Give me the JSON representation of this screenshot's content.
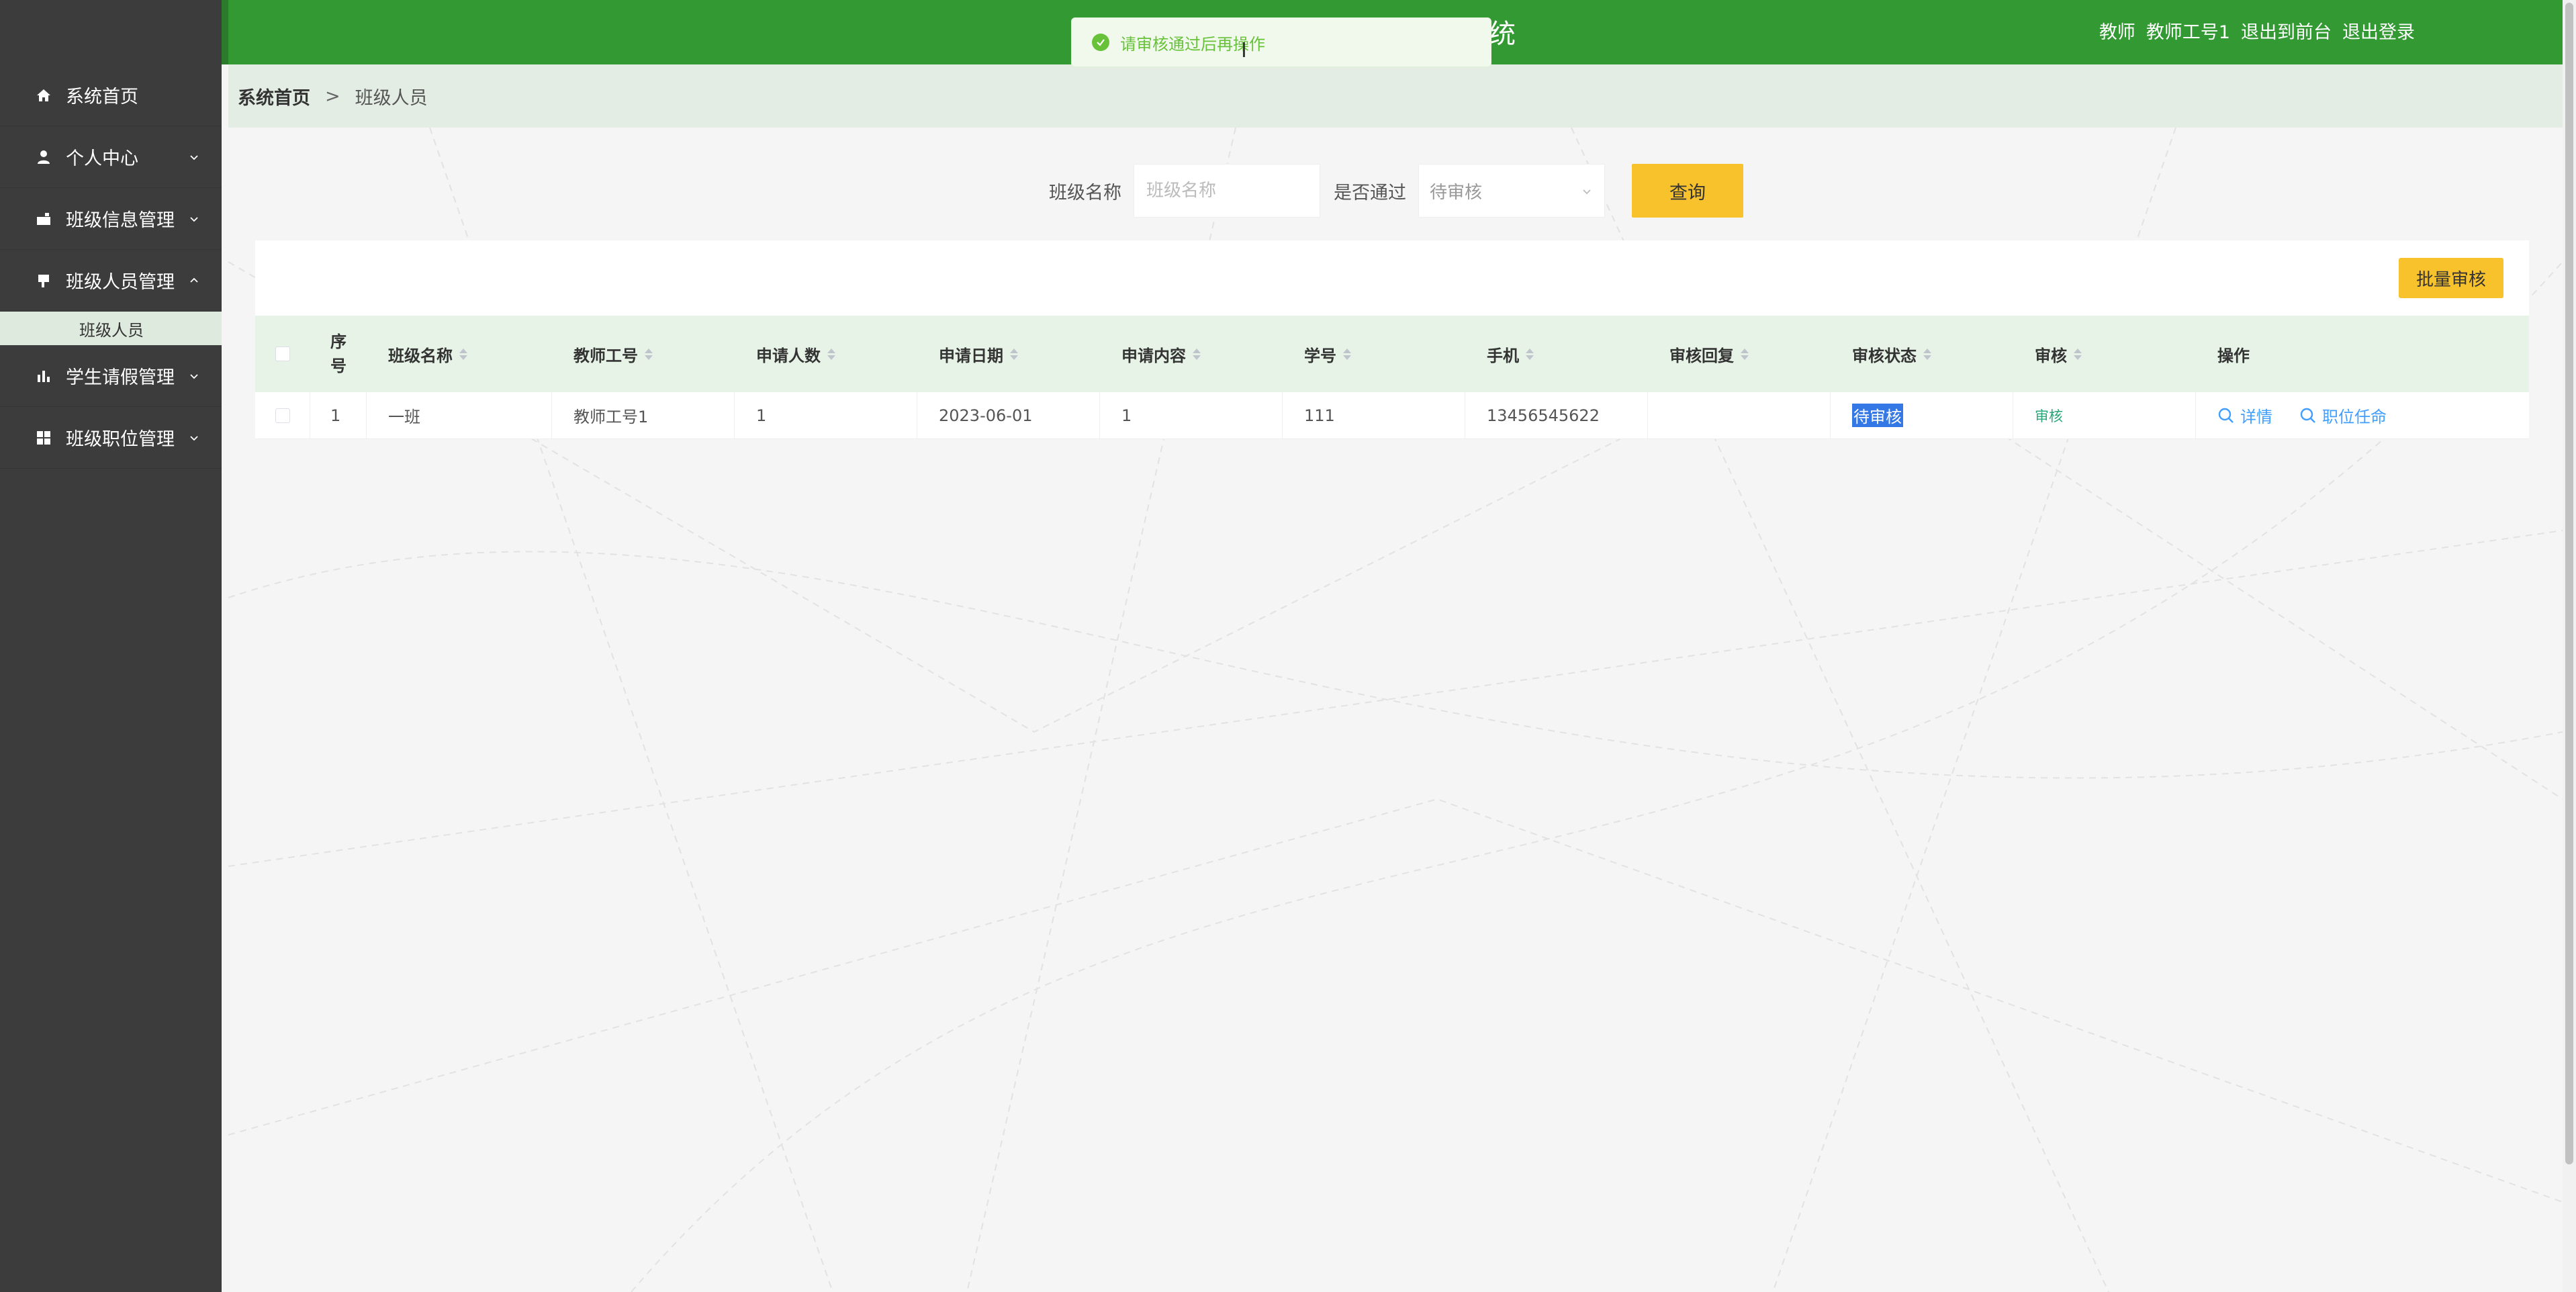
{
  "header": {
    "title": "统",
    "user_role": "教师",
    "user_name": "教师工号1",
    "back_to_front": "退出到前台",
    "logout": "退出登录"
  },
  "toast": {
    "message": "请审核通过后再操作"
  },
  "sidebar": {
    "items": [
      {
        "label": "系统首页",
        "icon": "home-icon"
      },
      {
        "label": "个人中心",
        "icon": "user-icon"
      },
      {
        "label": "班级信息管理",
        "icon": "briefcase-icon"
      },
      {
        "label": "班级人员管理",
        "icon": "flag-icon"
      },
      {
        "label": "学生请假管理",
        "icon": "bar-chart-icon"
      },
      {
        "label": "班级职位管理",
        "icon": "grid-icon"
      }
    ],
    "submenu": {
      "label": "班级人员"
    }
  },
  "breadcrumb": {
    "home": "系统首页",
    "separator": ">",
    "current": "班级人员"
  },
  "search": {
    "class_label": "班级名称",
    "class_placeholder": "班级名称",
    "pass_label": "是否通过",
    "pass_selected": "待审核",
    "query_button": "查询"
  },
  "toolbar": {
    "batch_audit": "批量审核"
  },
  "table": {
    "headers": {
      "index": "序号",
      "class_name": "班级名称",
      "teacher_no": "教师工号",
      "apply_count": "申请人数",
      "apply_date": "申请日期",
      "apply_content": "申请内容",
      "student_no": "学号",
      "phone": "手机",
      "audit_reply": "审核回复",
      "audit_status": "审核状态",
      "audit": "审核",
      "actions": "操作"
    },
    "rows": [
      {
        "index": "1",
        "class_name": "一班",
        "teacher_no": "教师工号1",
        "apply_count": "1",
        "apply_date": "2023-06-01",
        "apply_content": "1",
        "student_no": "111",
        "phone": "13456545622",
        "audit_reply": "",
        "audit_status": "待审核",
        "audit": "审核",
        "detail": "详情",
        "appoint": "职位任命"
      }
    ]
  },
  "colors": {
    "header_green": "#339933",
    "sidebar_bg": "#3c3c3c",
    "button_yellow": "#f8c22d",
    "link_blue": "#409eff"
  }
}
